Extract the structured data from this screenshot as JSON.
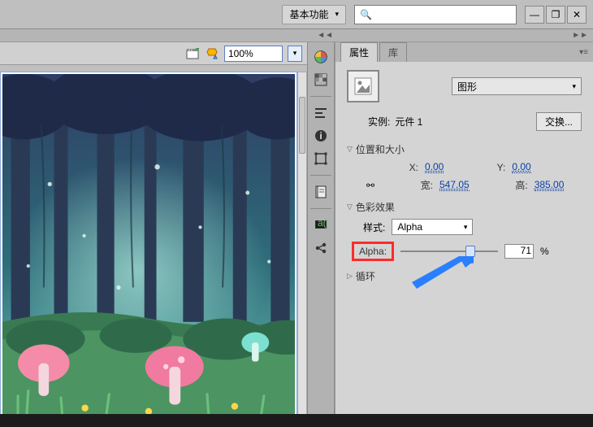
{
  "topbar": {
    "workspace_label": "基本功能",
    "search_placeholder": ""
  },
  "canvas_toolbar": {
    "zoom_value": "100%"
  },
  "panels": {
    "tabs": {
      "properties": "属性",
      "library": "库"
    }
  },
  "symbol": {
    "type_label": "图形",
    "instance_label": "实例:",
    "instance_name": "元件 1",
    "swap_label": "交换..."
  },
  "sections": {
    "pos_size": {
      "title": "位置和大小",
      "x_label": "X:",
      "x_value": "0.00",
      "y_label": "Y:",
      "y_value": "0.00",
      "w_label": "宽:",
      "w_value": "547.05",
      "h_label": "高:",
      "h_value": "385.00"
    },
    "color_effect": {
      "title": "色彩效果",
      "style_label": "样式:",
      "style_value": "Alpha",
      "alpha_label": "Alpha:",
      "alpha_value": "71",
      "alpha_unit": "%"
    },
    "loop": {
      "title": "循环"
    }
  },
  "icons": {
    "chevron_down": "▾",
    "chevron_left": "◄◄",
    "chevron_right": "►►",
    "search": "🔍",
    "minimize": "—",
    "restore": "❐",
    "close": "✕",
    "twisty_open": "▽",
    "twisty_closed": "▷",
    "menu": "▾≡",
    "lock": "⚯"
  }
}
